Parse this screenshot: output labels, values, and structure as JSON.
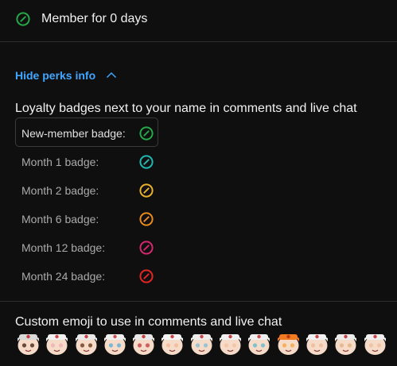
{
  "membership": {
    "status_text": "Member for 0 days",
    "icon": "member-badge-icon",
    "color": "#22a845"
  },
  "perks_toggle": {
    "label": "Hide perks info",
    "icon": "chevron-up-icon"
  },
  "loyalty": {
    "title": "Loyalty badges next to your name in comments and live chat",
    "badges": [
      {
        "label": "New-member badge:",
        "color": "#22a845",
        "icon": "new-member-badge-icon"
      },
      {
        "label": "Month 1 badge:",
        "color": "#1fb8b0",
        "icon": "month-1-badge-icon"
      },
      {
        "label": "Month 2 badge:",
        "color": "#e6b02a",
        "icon": "month-2-badge-icon"
      },
      {
        "label": "Month 6 badge:",
        "color": "#e8891c",
        "icon": "month-6-badge-icon"
      },
      {
        "label": "Month 12 badge:",
        "color": "#d6266f",
        "icon": "month-12-badge-icon"
      },
      {
        "label": "Month 24 badge:",
        "color": "#e22525",
        "icon": "month-24-badge-icon"
      }
    ]
  },
  "emoji": {
    "title": "Custom emoji to use in comments and live chat",
    "items": [
      {
        "icon": "custom-emoji-sunglasses-icon"
      },
      {
        "icon": "custom-emoji-blush-icon"
      },
      {
        "icon": "custom-emoji-grin-icon"
      },
      {
        "icon": "custom-emoji-cry-icon"
      },
      {
        "icon": "custom-emoji-angry-icon"
      },
      {
        "icon": "custom-emoji-laugh-icon"
      },
      {
        "icon": "custom-emoji-smile-icon"
      },
      {
        "icon": "custom-emoji-wink-icon"
      },
      {
        "icon": "custom-emoji-surprised-icon"
      },
      {
        "icon": "custom-emoji-chibi-icon"
      },
      {
        "icon": "custom-emoji-tongue-icon"
      },
      {
        "icon": "custom-emoji-happy-icon"
      },
      {
        "icon": "custom-emoji-calm-icon"
      }
    ]
  }
}
